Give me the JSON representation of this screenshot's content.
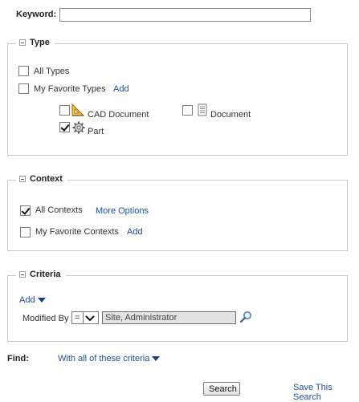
{
  "keyword": {
    "label": "Keyword:",
    "value": ""
  },
  "type_section": {
    "title": "Type",
    "all_types": {
      "label": "All Types",
      "checked": false
    },
    "favorite_types": {
      "label": "My Favorite Types",
      "checked": false,
      "add_label": "Add"
    },
    "items": [
      {
        "label": "CAD Document",
        "icon": "cad-document-icon",
        "checked": false
      },
      {
        "label": "Document",
        "icon": "document-icon",
        "checked": false
      },
      {
        "label": "Part",
        "icon": "part-gear-icon",
        "checked": true
      }
    ]
  },
  "context_section": {
    "title": "Context",
    "all_contexts": {
      "label": "All Contexts",
      "checked": true
    },
    "more_options": "More Options",
    "favorite_contexts": {
      "label": "My Favorite Contexts",
      "checked": false,
      "add_label": "Add"
    }
  },
  "criteria_section": {
    "title": "Criteria",
    "add_label": "Add",
    "row": {
      "label": "Modified By",
      "operator": "=",
      "value": "Site, Administrator"
    }
  },
  "find": {
    "label": "Find:",
    "option": "With all of these criteria"
  },
  "actions": {
    "search_label": "Search",
    "save_search_label": "Save This Search"
  }
}
